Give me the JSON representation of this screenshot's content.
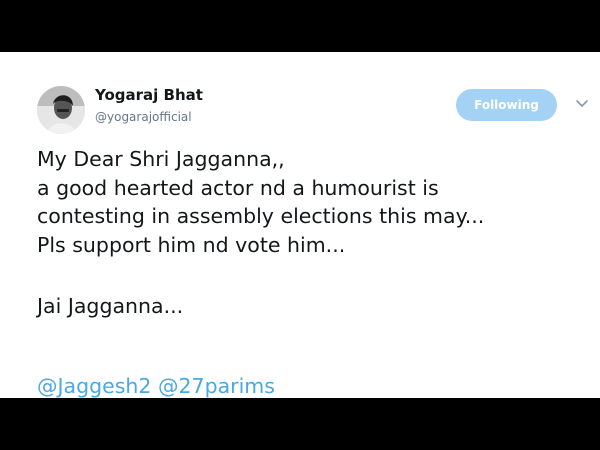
{
  "author": {
    "display_name": "Yogaraj Bhat",
    "handle": "@yogarajofficial"
  },
  "follow_button": {
    "label": "Following"
  },
  "tweet": {
    "lines": [
      "My Dear Shri Jagganna,,",
      "a good hearted actor nd a humourist is",
      "contesting in assembly elections this may...",
      "Pls support him nd vote him...",
      "Jai Jagganna..."
    ],
    "mentions": [
      "@Jaggesh2",
      "@27parims"
    ]
  },
  "icons": {
    "avatar": "profile-photo",
    "menu": "chevron-down-icon"
  },
  "colors": {
    "following_button_bg": "#a3d2f4",
    "mention_link": "#4aa8e6",
    "handle_text": "#657786",
    "primary_text": "#14171a",
    "frame": "#000000"
  }
}
